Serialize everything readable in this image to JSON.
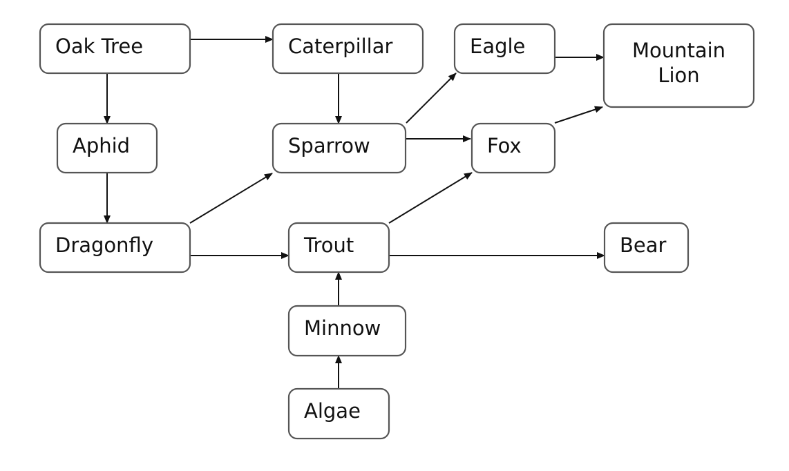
{
  "nodes": [
    {
      "id": "oak",
      "label": "Oak Tree"
    },
    {
      "id": "caterpillar",
      "label": "Caterpillar"
    },
    {
      "id": "eagle",
      "label": "Eagle"
    },
    {
      "id": "lion",
      "label": "Mountain Lion",
      "lines": [
        "Mountain",
        "Lion"
      ]
    },
    {
      "id": "aphid",
      "label": "Aphid"
    },
    {
      "id": "sparrow",
      "label": "Sparrow"
    },
    {
      "id": "fox",
      "label": "Fox"
    },
    {
      "id": "dragonfly",
      "label": "Dragonfly"
    },
    {
      "id": "trout",
      "label": "Trout"
    },
    {
      "id": "bear",
      "label": "Bear"
    },
    {
      "id": "minnow",
      "label": "Minnow"
    },
    {
      "id": "algae",
      "label": "Algae"
    }
  ],
  "edges": [
    {
      "from": "oak",
      "to": "caterpillar"
    },
    {
      "from": "oak",
      "to": "aphid"
    },
    {
      "from": "caterpillar",
      "to": "sparrow"
    },
    {
      "from": "aphid",
      "to": "dragonfly"
    },
    {
      "from": "sparrow",
      "to": "eagle"
    },
    {
      "from": "sparrow",
      "to": "fox"
    },
    {
      "from": "eagle",
      "to": "lion"
    },
    {
      "from": "fox",
      "to": "lion"
    },
    {
      "from": "dragonfly",
      "to": "sparrow"
    },
    {
      "from": "dragonfly",
      "to": "trout"
    },
    {
      "from": "trout",
      "to": "fox"
    },
    {
      "from": "trout",
      "to": "bear"
    },
    {
      "from": "minnow",
      "to": "trout"
    },
    {
      "from": "algae",
      "to": "minnow"
    }
  ]
}
